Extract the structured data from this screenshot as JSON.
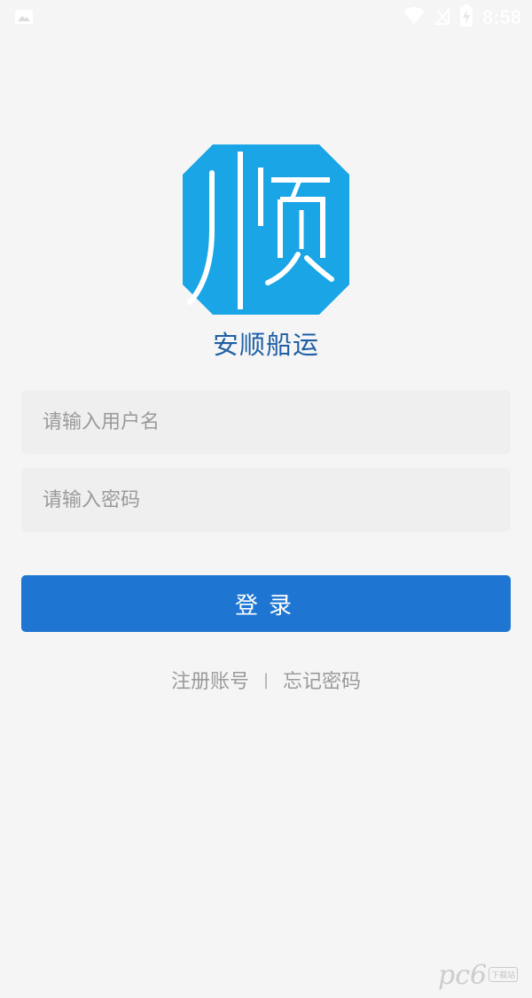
{
  "status_bar": {
    "time": "8:58",
    "icons": [
      "image-notification-icon",
      "wifi-icon",
      "signal-off-icon",
      "battery-charging-icon"
    ]
  },
  "logo": {
    "glyph": "顺",
    "color": "#1aa5e6"
  },
  "app_name": "安顺船运",
  "form": {
    "username_placeholder": "请输入用户名",
    "password_placeholder": "请输入密码",
    "username_value": "",
    "password_value": ""
  },
  "login_button": {
    "label": "登录",
    "color": "#1e76d2"
  },
  "links": {
    "register": "注册账号",
    "separator": "|",
    "forgot": "忘记密码"
  },
  "watermark": {
    "text": "pc6",
    "sub": "下载站"
  },
  "colors": {
    "background": "#f5f5f5",
    "brand_text": "#1f5fa6",
    "link_text": "#9b9b9b"
  }
}
